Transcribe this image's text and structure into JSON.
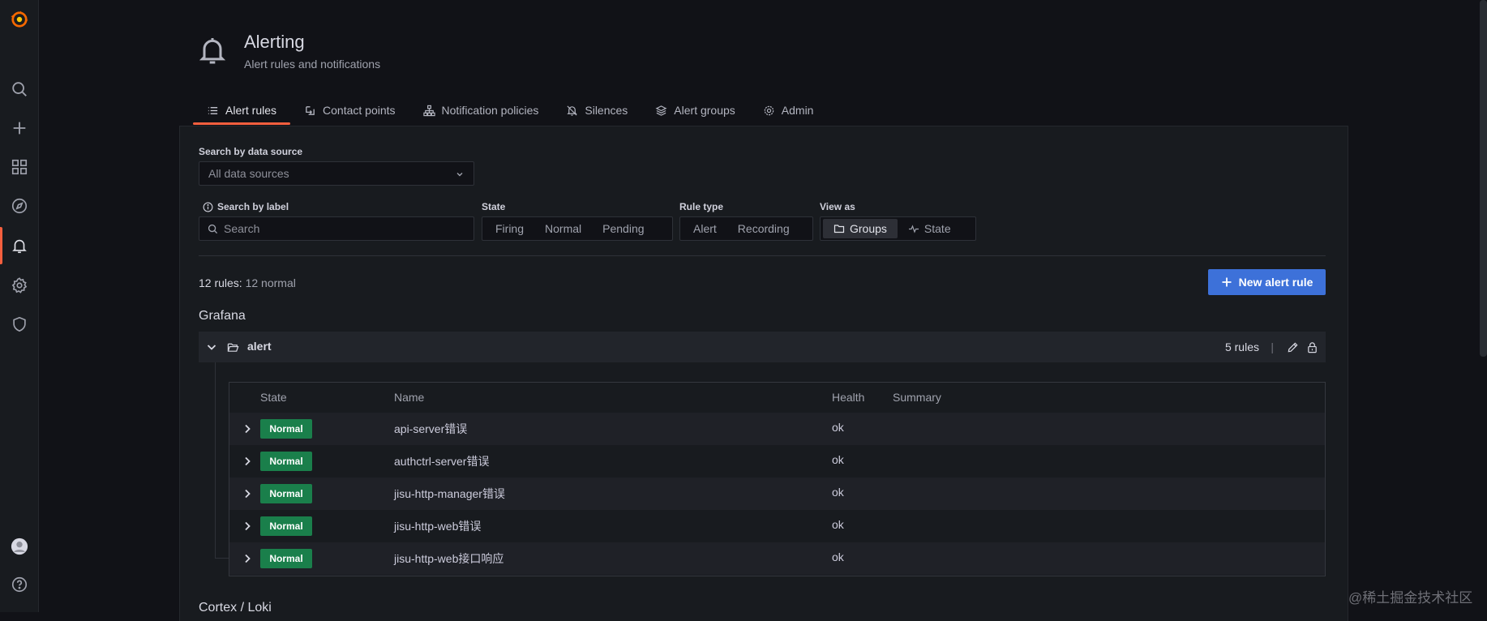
{
  "sidebar": {
    "items": [
      {
        "name": "grafana-logo-icon"
      },
      {
        "name": "search-icon"
      },
      {
        "name": "plus-icon"
      },
      {
        "name": "dashboards-icon"
      },
      {
        "name": "explore-compass-icon"
      },
      {
        "name": "alerting-bell-icon",
        "active": true
      },
      {
        "name": "configuration-gear-icon"
      },
      {
        "name": "server-admin-shield-icon"
      },
      {
        "name": "user-avatar-icon"
      },
      {
        "name": "help-icon"
      }
    ]
  },
  "header": {
    "icon": "bell-icon",
    "title": "Alerting",
    "subtitle": "Alert rules and notifications"
  },
  "tabs": [
    {
      "label": "Alert rules",
      "icon": "list-icon",
      "active": true
    },
    {
      "label": "Contact points",
      "icon": "comment-alt-share-icon"
    },
    {
      "label": "Notification policies",
      "icon": "sitemap-icon"
    },
    {
      "label": "Silences",
      "icon": "bell-slash-icon"
    },
    {
      "label": "Alert groups",
      "icon": "layer-group-icon"
    },
    {
      "label": "Admin",
      "icon": "cog-icon"
    }
  ],
  "filters": {
    "datasource_label": "Search by data source",
    "datasource_value": "All data sources",
    "label_search_label": "Search by label",
    "search_placeholder": "Search",
    "state_label": "State",
    "state_options": [
      "Firing",
      "Normal",
      "Pending"
    ],
    "rule_type_label": "Rule type",
    "rule_type_options": [
      "Alert",
      "Recording"
    ],
    "view_as_label": "View as",
    "view_as_options": [
      "Groups",
      "State"
    ],
    "view_as_selected": "Groups"
  },
  "summary": {
    "count": "12 rules:",
    "status": "12 normal"
  },
  "new_rule_button": "New alert rule",
  "namespace": {
    "title": "Grafana",
    "group": {
      "name": "alert",
      "rules_count": "5 rules",
      "separator": "|"
    }
  },
  "table": {
    "headers": [
      "State",
      "Name",
      "Health",
      "Summary"
    ],
    "rows": [
      {
        "state": "Normal",
        "name": "api-server错误",
        "health": "ok"
      },
      {
        "state": "Normal",
        "name": "authctrl-server错误",
        "health": "ok"
      },
      {
        "state": "Normal",
        "name": "jisu-http-manager错误",
        "health": "ok"
      },
      {
        "state": "Normal",
        "name": "jisu-http-web错误",
        "health": "ok"
      },
      {
        "state": "Normal",
        "name": "jisu-http-web接口响应",
        "health": "ok"
      }
    ]
  },
  "next_namespace": "Cortex / Loki",
  "watermark": "@稀土掘金技术社区",
  "colors": {
    "background": "#111217",
    "panel": "#181b1f",
    "accent": "#f55f3e",
    "primary_button": "#3d71d9",
    "normal_badge": "#1a7f4b"
  }
}
